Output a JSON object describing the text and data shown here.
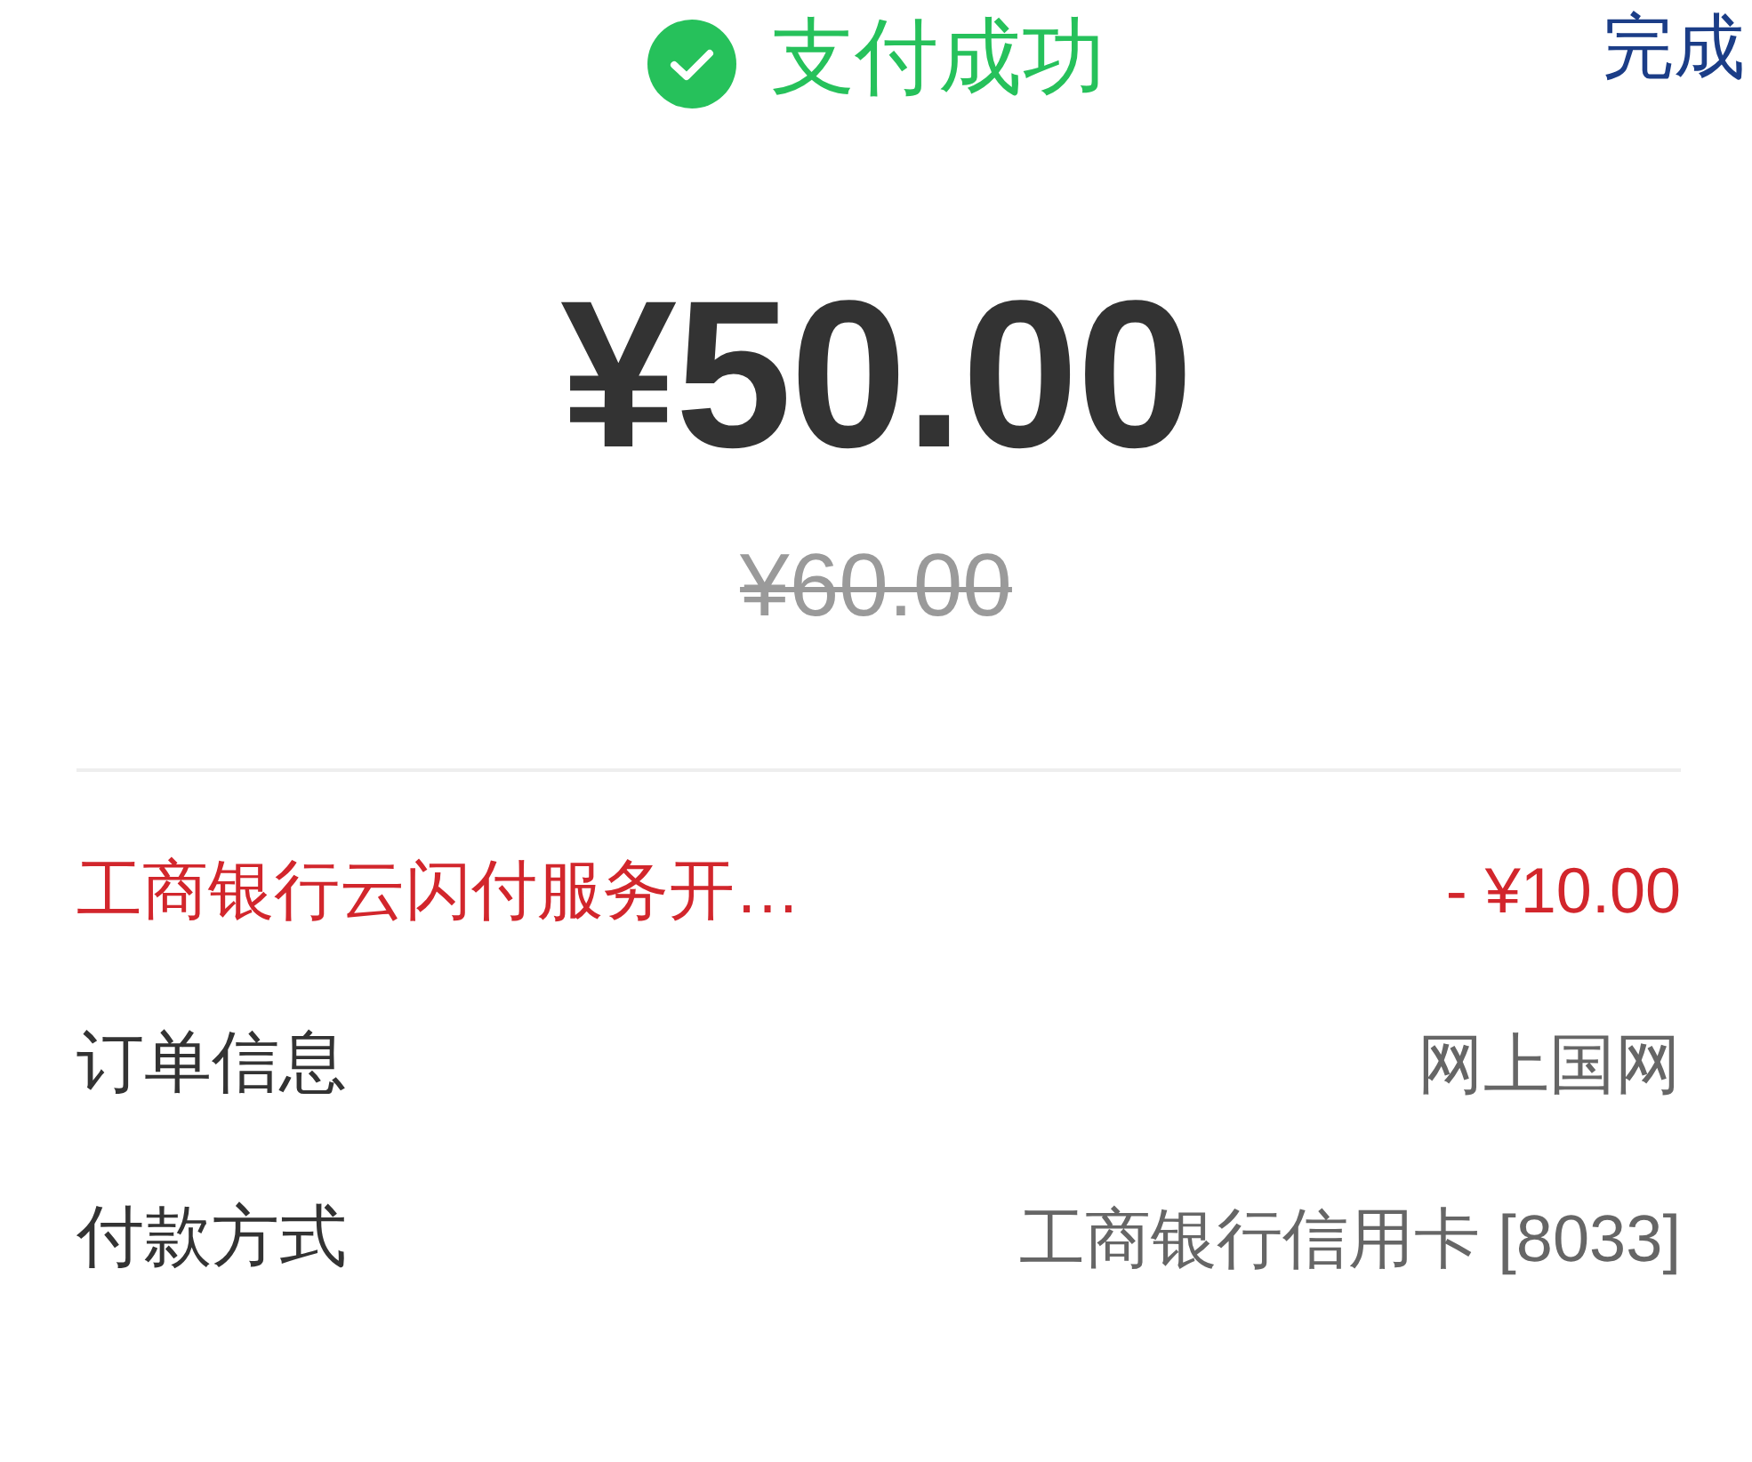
{
  "header": {
    "title": "支付成功",
    "done_button": "完成"
  },
  "amount": {
    "paid": "¥50.00",
    "original": "¥60.00"
  },
  "details": [
    {
      "kind": "discount",
      "label": "工商银行云闪付服务开…",
      "value": "- ¥10.00"
    },
    {
      "kind": "info",
      "label": "订单信息",
      "value": "网上国网"
    },
    {
      "kind": "info",
      "label": "付款方式",
      "value": "工商银行信用卡 [8033]"
    }
  ]
}
